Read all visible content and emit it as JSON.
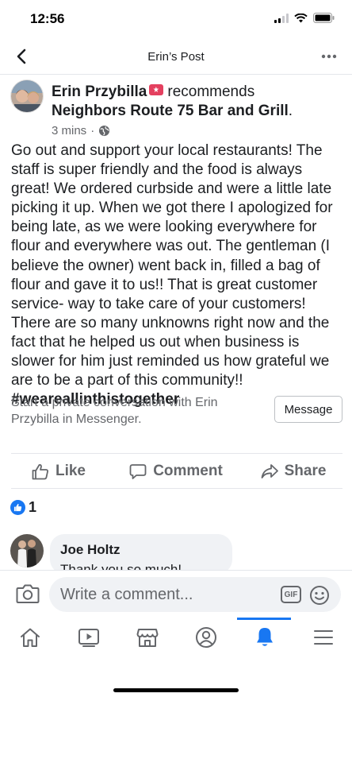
{
  "status": {
    "time": "12:56"
  },
  "header": {
    "title": "Erin’s Post"
  },
  "post": {
    "author": "Erin Przybilla",
    "action": "recommends",
    "place": "Neighbors Route 75 Bar and Grill",
    "place_suffix": ".",
    "time": "3 mins",
    "separator": "·",
    "body": "Go out and support your local restaurants! The staff is super friendly and the food is always great! We ordered curbside and were a little late picking it up. When we got there I apologized for being late, as we were looking everywhere for flour and everywhere was out. The gentleman (I believe the owner) went back in, filled a bag of flour and gave it to us!! That is great customer service- way to take care of your customers! There are so many unknowns right now and the fact that he helped us out when business is slower for him just reminded us how grateful we are to be a part of this community!!",
    "hashtag": "#weareallinthistogether"
  },
  "messenger": {
    "prompt": "Start a private conversation with Erin Przybilla in Messenger.",
    "button": "Message"
  },
  "actions": {
    "like": "Like",
    "comment": "Comment",
    "share": "Share"
  },
  "reactions": {
    "count": "1"
  },
  "comments": [
    {
      "name": "Joe Holtz",
      "text": "Thank you so much!"
    }
  ],
  "comment_bar": {
    "placeholder": "Write a comment...",
    "gif": "GIF"
  },
  "tabs": [
    "home-icon",
    "watch-icon",
    "marketplace-icon",
    "profile-icon",
    "notifications-icon",
    "menu-icon"
  ],
  "colors": {
    "accent": "#1877f2",
    "badge": "#e4405f",
    "muted": "#65676b"
  }
}
